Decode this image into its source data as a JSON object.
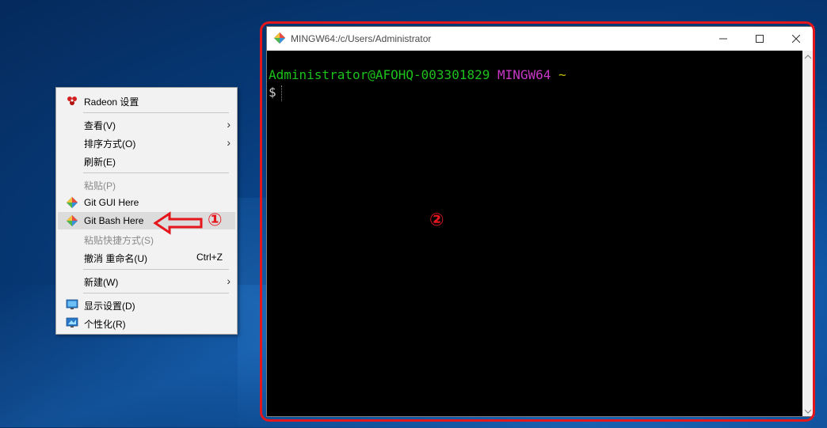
{
  "context_menu": {
    "items": [
      {
        "label": "Radeon 设置"
      },
      {
        "label": "查看(V)"
      },
      {
        "label": "排序方式(O)"
      },
      {
        "label": "刷新(E)"
      },
      {
        "label": "粘贴(P)"
      },
      {
        "label": "Git GUI Here"
      },
      {
        "label": "Git Bash Here"
      },
      {
        "label": "粘贴快捷方式(S)"
      },
      {
        "label": "撤消 重命名(U)",
        "shortcut": "Ctrl+Z"
      },
      {
        "label": "新建(W)"
      },
      {
        "label": "显示设置(D)"
      },
      {
        "label": "个性化(R)"
      }
    ],
    "submenu_arrow": "›"
  },
  "annotations": {
    "step1": "①",
    "step2": "②",
    "color": "#e5161c"
  },
  "terminal_window": {
    "title": "MINGW64:/c/Users/Administrator",
    "controls": {
      "minimize": "—",
      "maximize": "☐",
      "close": "✕"
    },
    "prompt_user": "Administrator@AFOHQ-003301829",
    "prompt_system": "MINGW64",
    "prompt_path": "~",
    "prompt_symbol": "$"
  },
  "colors": {
    "desktop": "#0d4f9c",
    "prompt_user": "#1cc11c",
    "prompt_system": "#c838c8",
    "prompt_path": "#c0c000"
  },
  "icons": {
    "radeon": "radeon-icon",
    "git": "git-icon",
    "display": "display-settings-icon",
    "personalize": "personalize-icon"
  }
}
